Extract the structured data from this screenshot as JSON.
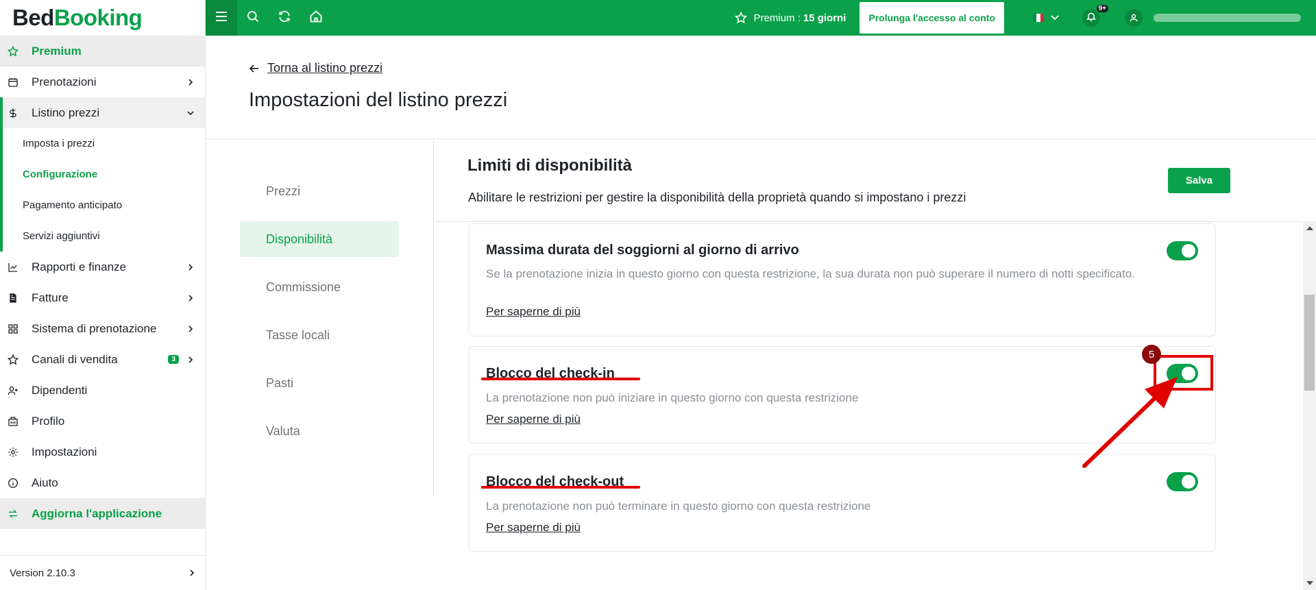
{
  "app": {
    "logo_part1": "Bed",
    "logo_part2": "Booking"
  },
  "topbar": {
    "premium_label": "Premium :",
    "premium_days": "15 giorni",
    "extend_button": "Prolunga l'accesso al conto",
    "notifications_count": "9+",
    "language": "it",
    "icons": [
      "menu-icon",
      "search-icon",
      "refresh-icon",
      "home-icon",
      "star-icon",
      "chevron-down-icon",
      "bell-icon",
      "user-icon"
    ]
  },
  "sidebar": {
    "premium": "Premium",
    "items": [
      {
        "label": "Prenotazioni",
        "icon": "calendar-icon"
      },
      {
        "label": "Listino prezzi",
        "icon": "dollar-icon"
      },
      {
        "label": "Rapporti e finanze",
        "icon": "chart-icon"
      },
      {
        "label": "Fatture",
        "icon": "invoice-icon"
      },
      {
        "label": "Sistema di prenotazione",
        "icon": "grid-icon"
      },
      {
        "label": "Canali di vendita",
        "icon": "star-icon",
        "badge": "3"
      },
      {
        "label": "Dipendenti",
        "icon": "user-add-icon"
      },
      {
        "label": "Profilo",
        "icon": "building-icon"
      },
      {
        "label": "Impostazioni",
        "icon": "gear-icon"
      },
      {
        "label": "Aiuto",
        "icon": "info-icon"
      }
    ],
    "sub_items": [
      "Imposta i prezzi",
      "Configurazione",
      "Pagamento anticipato",
      "Servizi aggiuntivi"
    ],
    "upgrade": "Aggiorna l'applicazione",
    "version": "Version 2.10.3"
  },
  "main": {
    "back_link": "Torna al listino prezzi",
    "page_title": "Impostazioni del listino prezzi",
    "tabs": [
      "Prezzi",
      "Disponibilità",
      "Commissione",
      "Tasse locali",
      "Pasti",
      "Valuta"
    ],
    "active_tab": "Disponibilità",
    "section": {
      "title": "Limiti di disponibilità",
      "description": "Abilitare le restrizioni per gestire la disponibilità della proprietà quando si impostano i prezzi",
      "save_button": "Salva"
    },
    "cards": [
      {
        "title": "Massima durata del soggiorni al giorno di arrivo",
        "description": "Se la prenotazione inizia in questo giorno con questa restrizione, la sua durata non può superare il numero di notti specificato.",
        "link": "Per saperne di più",
        "enabled": true
      },
      {
        "title": "Blocco del check-in",
        "description": "La prenotazione non può iniziare in questo giorno con questa restrizione",
        "link": "Per saperne di più",
        "enabled": true
      },
      {
        "title": "Blocco del check-out",
        "description": "La prenotazione non può terminare in questo giorno con questa restrizione",
        "link": "Per saperne di più",
        "enabled": true
      }
    ]
  },
  "annotation": {
    "step_number": "5",
    "color": "#e00000"
  },
  "colors": {
    "brand": "#0ba14a",
    "brand_dark": "#08893e",
    "text": "#1f2328",
    "muted": "#8a8f94"
  }
}
